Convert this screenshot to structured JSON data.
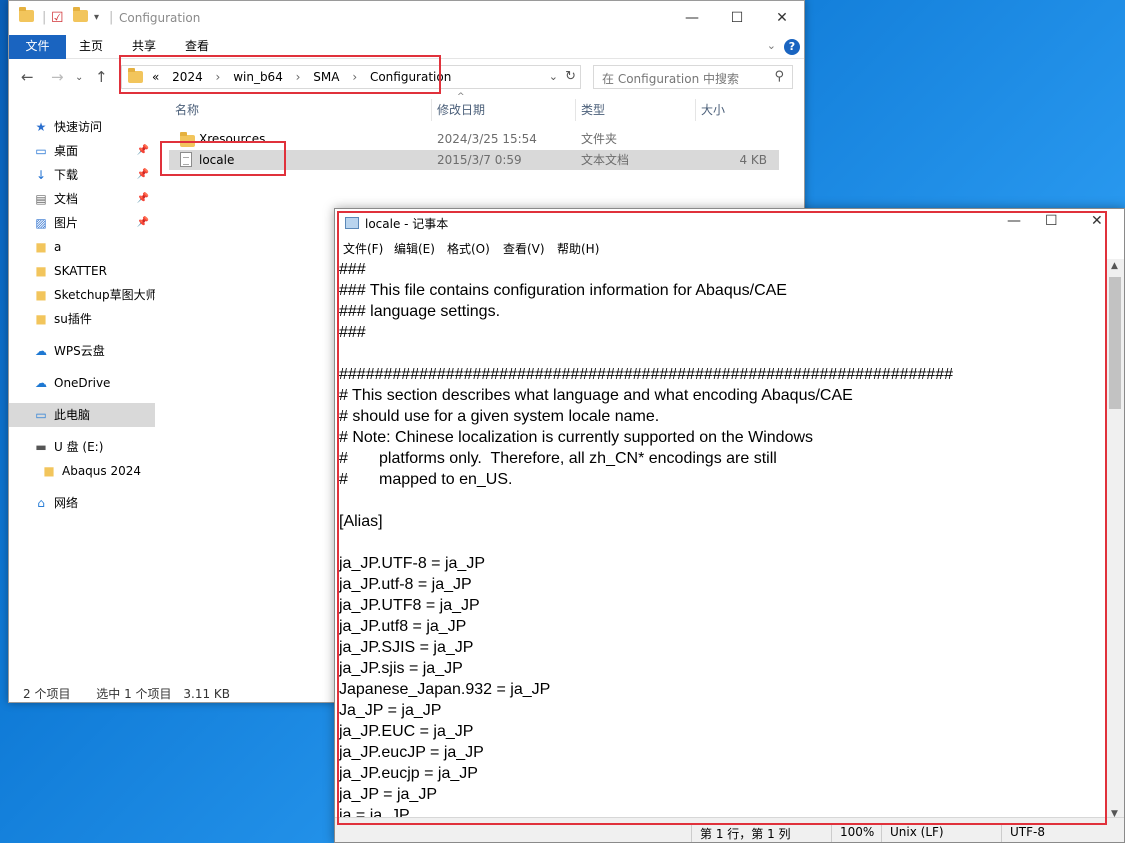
{
  "explorer": {
    "title": "Configuration",
    "ribbon_tabs": [
      "文件",
      "主页",
      "共享",
      "查看"
    ],
    "help": "?",
    "breadcrumb": [
      "«",
      "2024",
      "win_b64",
      "SMA",
      "Configuration"
    ],
    "search_placeholder": "在 Configuration 中搜索",
    "nav_items": [
      {
        "label": "快速访问",
        "icon": "star-icon"
      },
      {
        "label": "桌面",
        "icon": "desktop-icon",
        "pinned": true
      },
      {
        "label": "下载",
        "icon": "download-icon",
        "pinned": true
      },
      {
        "label": "文档",
        "icon": "document-icon",
        "pinned": true
      },
      {
        "label": "图片",
        "icon": "picture-icon",
        "pinned": true
      },
      {
        "label": "a",
        "icon": "folder-icon"
      },
      {
        "label": "SKATTER",
        "icon": "folder-icon"
      },
      {
        "label": "Sketchup草图大师",
        "icon": "folder-icon"
      },
      {
        "label": "su插件",
        "icon": "folder-icon"
      },
      {
        "label": "WPS云盘",
        "icon": "cloud-icon"
      },
      {
        "label": "OneDrive",
        "icon": "cloud-icon"
      },
      {
        "label": "此电脑",
        "icon": "computer-icon",
        "selected": true
      },
      {
        "label": "U 盘 (E:)",
        "icon": "usb-drive-icon"
      },
      {
        "label": "Abaqus 2024",
        "icon": "folder-icon"
      },
      {
        "label": "网络",
        "icon": "network-icon"
      }
    ],
    "columns": [
      "名称",
      "修改日期",
      "类型",
      "大小"
    ],
    "files": [
      {
        "name": "Xresources",
        "date": "2024/3/25 15:54",
        "type": "文件夹",
        "size": "",
        "icon": "folder-icon"
      },
      {
        "name": "locale",
        "date": "2015/3/7 0:59",
        "type": "文本文档",
        "size": "4 KB",
        "icon": "text-file-icon",
        "selected": true
      }
    ],
    "status": {
      "count": "2 个项目",
      "selected": "选中 1 个项目",
      "size": "3.11 KB"
    }
  },
  "notepad": {
    "title": "locale - 记事本",
    "menu": [
      "文件(F)",
      "编辑(E)",
      "格式(O)",
      "查看(V)",
      "帮助(H)"
    ],
    "lines": [
      "###",
      "### This file contains configuration information for Abaqus/CAE",
      "### language settings.",
      "###",
      "",
      "#####################################################################",
      "# This section describes what language and what encoding Abaqus/CAE",
      "# should use for a given system locale name.",
      "# Note: Chinese localization is currently supported on the Windows",
      "#       platforms only.  Therefore, all zh_CN* encodings are still",
      "#       mapped to en_US.",
      "",
      "[Alias]",
      "",
      "ja_JP.UTF-8 = ja_JP",
      "ja_JP.utf-8 = ja_JP",
      "ja_JP.UTF8 = ja_JP",
      "ja_JP.utf8 = ja_JP",
      "ja_JP.SJIS = ja_JP",
      "ja_JP.sjis = ja_JP",
      "Japanese_Japan.932 = ja_JP",
      "Ja_JP = ja_JP",
      "ja_JP.EUC = ja_JP",
      "ja_JP.eucJP = ja_JP",
      "ja_JP.eucjp = ja_JP",
      "ja_JP = ja_JP",
      "ja = ja_JP"
    ],
    "status": {
      "position": "第 1 行，第 1 列",
      "zoom": "100%",
      "eol": "Unix (LF)",
      "encoding": "UTF-8"
    }
  }
}
